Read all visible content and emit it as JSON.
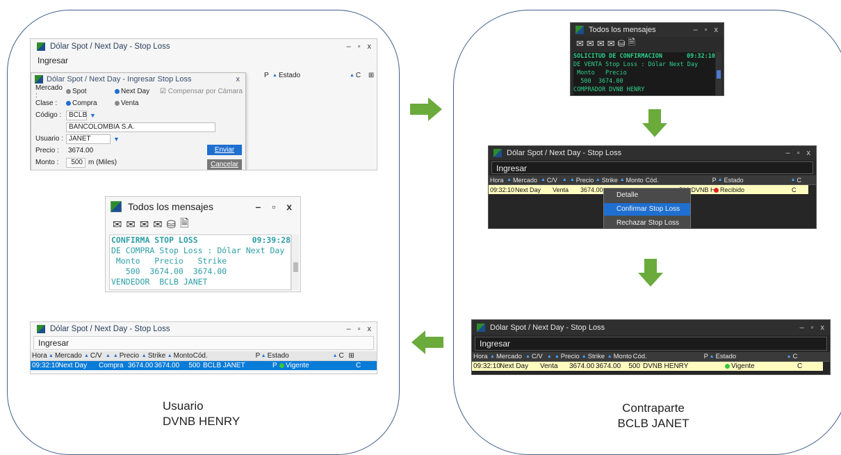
{
  "captions": {
    "left_line1": "Usuario",
    "left_line2": "DVNB HENRY",
    "right_line1": "Contraparte",
    "right_line2": "BCLB JANET"
  },
  "colors": {
    "arrow": "#6aab3c",
    "panel_border": "#3f5f8a",
    "dot_green": "#37c837",
    "dot_red": "#e02020",
    "row_highlight": "#fffcc0",
    "row_selected": "#0a7bd7"
  },
  "window_title": "Dólar Spot / Next Day - Stop Loss",
  "ingresar": "Ingresar",
  "win_controls": [
    "–",
    "▫",
    "x"
  ],
  "dialog": {
    "title": "Dólar Spot / Next Day - Ingresar Stop Loss",
    "close": "x",
    "mercado_label": "Mercado :",
    "spot": "Spot",
    "next_day": "Next Day",
    "compensar": "Compensar por Cámara",
    "clase_label": "Clase :",
    "compra": "Compra",
    "venta": "Venta",
    "codigo_label": "Código :",
    "codigo_value": "BCLB",
    "company": "BANCOLOMBIA S.A.",
    "usuario_label": "Usuario :",
    "usuario_value": "JANET",
    "precio_label": "Precio :",
    "precio_value": "3674.00",
    "monto_label": "Monto :",
    "monto_value": "500",
    "monto_unit": "m (Miles)",
    "enviar": "Enviar",
    "cancelar": "Cancelar"
  },
  "bg_header": {
    "p": "P",
    "estado": "Estado",
    "c": "C"
  },
  "messages_title": "Todos los mensajes",
  "message_light": {
    "line1": "CONFIRMA STOP LOSS",
    "time": "09:39:28",
    "line2": "DE COMPRA Stop Loss : Dólar Next Day",
    "line3": " Monto   Precio   Strike",
    "line4": "   500  3674.00  3674.00",
    "line5": "VENDEDOR  BCLB JANET"
  },
  "message_dark": {
    "line1": "SOLICITUD DE CONFIRMACION",
    "time": "09:32:10",
    "line2": "DE VENTA Stop Loss : Dólar Next Day",
    "line3": " Monto   Precio",
    "line4": "  500  3674.00",
    "line5": "COMPRADOR DVNB HENRY"
  },
  "columns": {
    "hora": "Hora",
    "mercado": "Mercado",
    "cv": "C/V",
    "precio": "Precio",
    "strike": "Strike",
    "monto": "Monto",
    "cod": "Cód.",
    "p": "P",
    "estado": "Estado",
    "c": "C"
  },
  "row_user": {
    "hora": "09:32:10",
    "mercado": "Next Day",
    "cv": "Compra",
    "precio": "3674.00",
    "strike": "3674.00",
    "monto": "500",
    "cod": "BCLB JANET",
    "p": "P",
    "estado": "Vigente",
    "c": "C"
  },
  "row_counter_recibido": {
    "hora": "09:32:10",
    "mercado": "Next Day",
    "cv": "Venta",
    "precio": "3674.00",
    "cod_partial": "500 DVNB HENRY",
    "estado": "Recibido",
    "c": "C"
  },
  "row_counter_vigente": {
    "hora": "09:32:10",
    "mercado": "Next Day",
    "cv": "Venta",
    "precio": "3674.00",
    "strike": "3674.00",
    "monto": "500",
    "cod": "DVNB HENRY",
    "estado": "Vigente",
    "c": "C"
  },
  "context_menu": [
    "Detalle",
    "Confirmar Stop Loss",
    "Rechazar Stop Loss"
  ]
}
